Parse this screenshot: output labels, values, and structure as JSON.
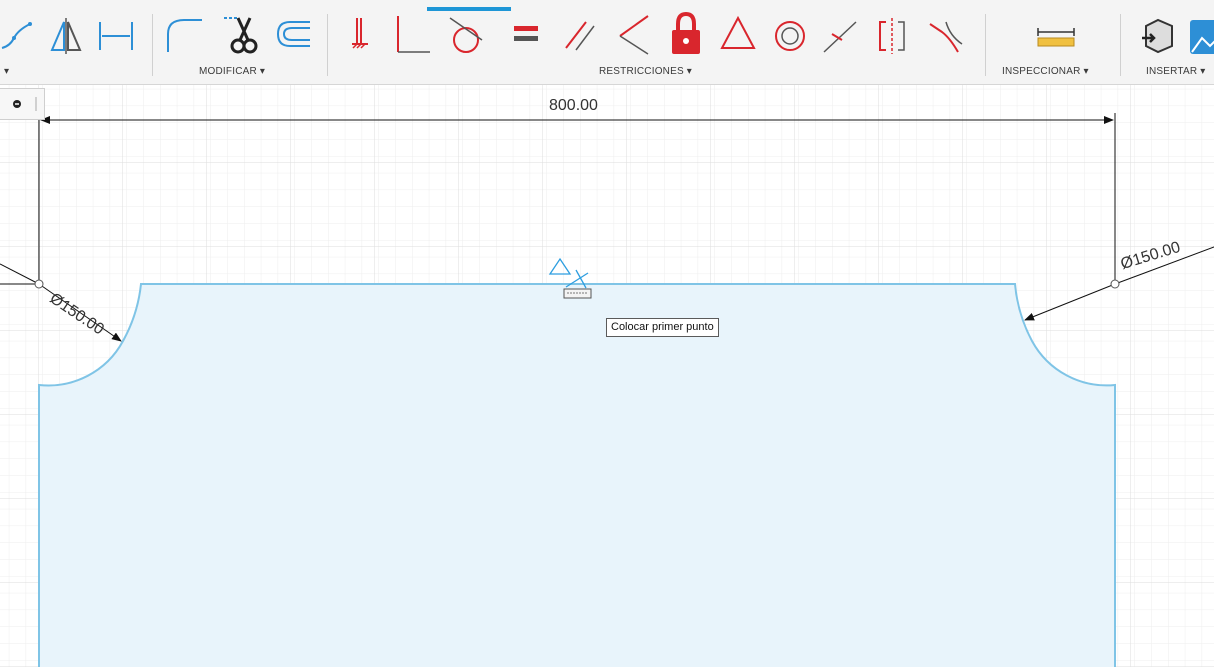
{
  "toolbar": {
    "groups": [
      {
        "label": "▾"
      },
      {
        "label": "MODIFICAR ▾"
      },
      {
        "label": "RESTRICCIONES ▾"
      },
      {
        "label": "INSPECCIONAR ▾"
      },
      {
        "label": "INSERTAR ▾"
      }
    ],
    "icons": {
      "create": [
        "spline-icon",
        "mirror-icon",
        "dimension-icon"
      ],
      "modify": [
        "fillet-icon",
        "trim-icon",
        "offset-icon"
      ],
      "constraints": [
        "fix-icon",
        "perpendicular-icon",
        "tangent-icon",
        "equal-icon",
        "parallel-icon",
        "coincident-icon",
        "lock-icon",
        "triangle-icon",
        "concentric-icon",
        "midpoint-icon",
        "symmetry-icon",
        "curvature-icon"
      ],
      "inspect": [
        "measure-icon"
      ],
      "insert": [
        "insert-derive-icon",
        "insert-image-icon"
      ]
    },
    "colors": {
      "accent": "#1e96d6",
      "constraint_red": "#d9262d"
    }
  },
  "sketch": {
    "dimension_width": "800.00",
    "dimension_left_diameter": "Ø150.00",
    "dimension_right_diameter": "Ø150.00",
    "profile_color": "#7fc4e6",
    "fill_color": "#e8f4fb"
  },
  "tooltip": {
    "text": "Colocar primer punto"
  }
}
